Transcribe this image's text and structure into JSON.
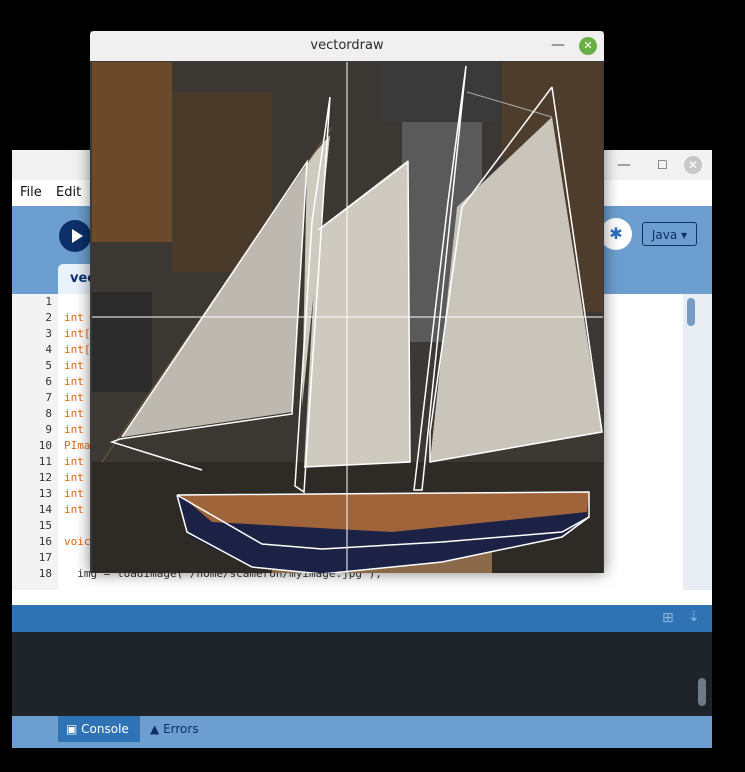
{
  "ide": {
    "menu": [
      "File",
      "Edit"
    ],
    "mode": "Java",
    "sketch_tab": "vec",
    "line_numbers": [
      "1",
      "2",
      "3",
      "4",
      "5",
      "6",
      "7",
      "8",
      "9",
      "10",
      "11",
      "12",
      "13",
      "14",
      "15",
      "16",
      "17",
      "18"
    ],
    "code_lines": [
      "",
      "int",
      "int[",
      "int[",
      "int",
      "int",
      "int",
      "int",
      "int",
      "PIma",
      "int",
      "int",
      "int",
      "int",
      "",
      "voic",
      "",
      "  img = loadImage(\"/home/scameron/myimage.jpg\");"
    ],
    "console_tab": "Console",
    "errors_tab": "Errors"
  },
  "vectordraw": {
    "title": "vectordraw"
  },
  "colors": {
    "accent": "#2f73b5",
    "toolbar": "#6c9fcf",
    "console_bg": "#1e242a",
    "close_green": "#6bb044"
  }
}
